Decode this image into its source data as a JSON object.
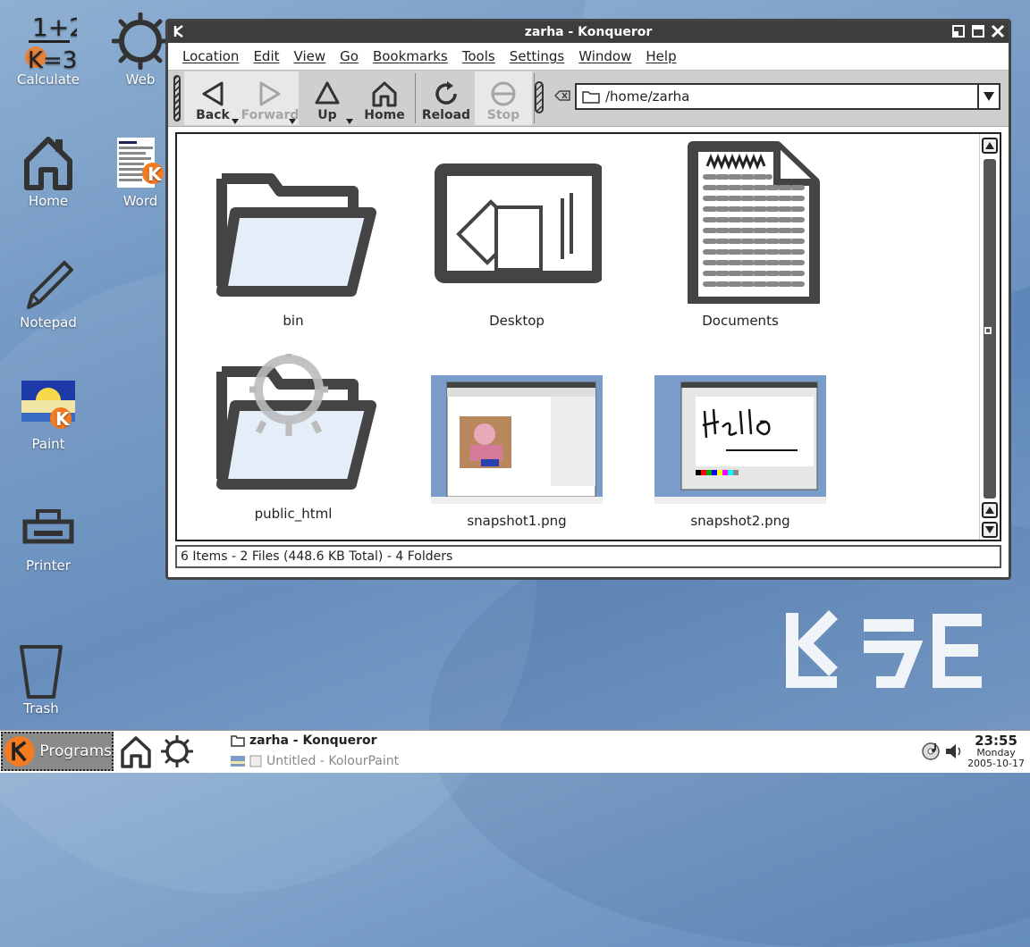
{
  "desktop": {
    "icons": [
      {
        "label": "Calculate"
      },
      {
        "label": "Web"
      },
      {
        "label": "Home"
      },
      {
        "label": "Word"
      },
      {
        "label": "Notepad"
      },
      {
        "label": "Paint"
      },
      {
        "label": "Printer"
      },
      {
        "label": "Trash"
      }
    ]
  },
  "window": {
    "title": "zarha - Konqueror",
    "menu": [
      "Location",
      "Edit",
      "View",
      "Go",
      "Bookmarks",
      "Tools",
      "Settings",
      "Window",
      "Help"
    ],
    "toolbar": {
      "back": "Back",
      "forward": "Forward",
      "up": "Up",
      "home": "Home",
      "reload": "Reload",
      "stop": "Stop"
    },
    "location": "/home/zarha",
    "files": [
      {
        "name": "bin",
        "icon": "folder-icon"
      },
      {
        "name": "Desktop",
        "icon": "desktop-icon"
      },
      {
        "name": "Documents",
        "icon": "document-icon"
      },
      {
        "name": "public_html",
        "icon": "web-folder-icon"
      },
      {
        "name": "snapshot1.png",
        "icon": "image-thumbnail"
      },
      {
        "name": "snapshot2.png",
        "icon": "image-thumbnail"
      }
    ],
    "status": "6 Items - 2 Files (448.6 KB Total) - 4 Folders"
  },
  "taskbar": {
    "programs_label": "Programs",
    "tasks": [
      {
        "label": "zarha - Konqueror"
      },
      {
        "label": "Untitled - KolourPaint"
      }
    ],
    "clock": {
      "time": "23:55",
      "day": "Monday",
      "date": "2005-10-17"
    }
  },
  "colors": {
    "accent": "#f47b20",
    "window_frame": "#3d3d3d",
    "toolbar": "#cfcfcf"
  }
}
